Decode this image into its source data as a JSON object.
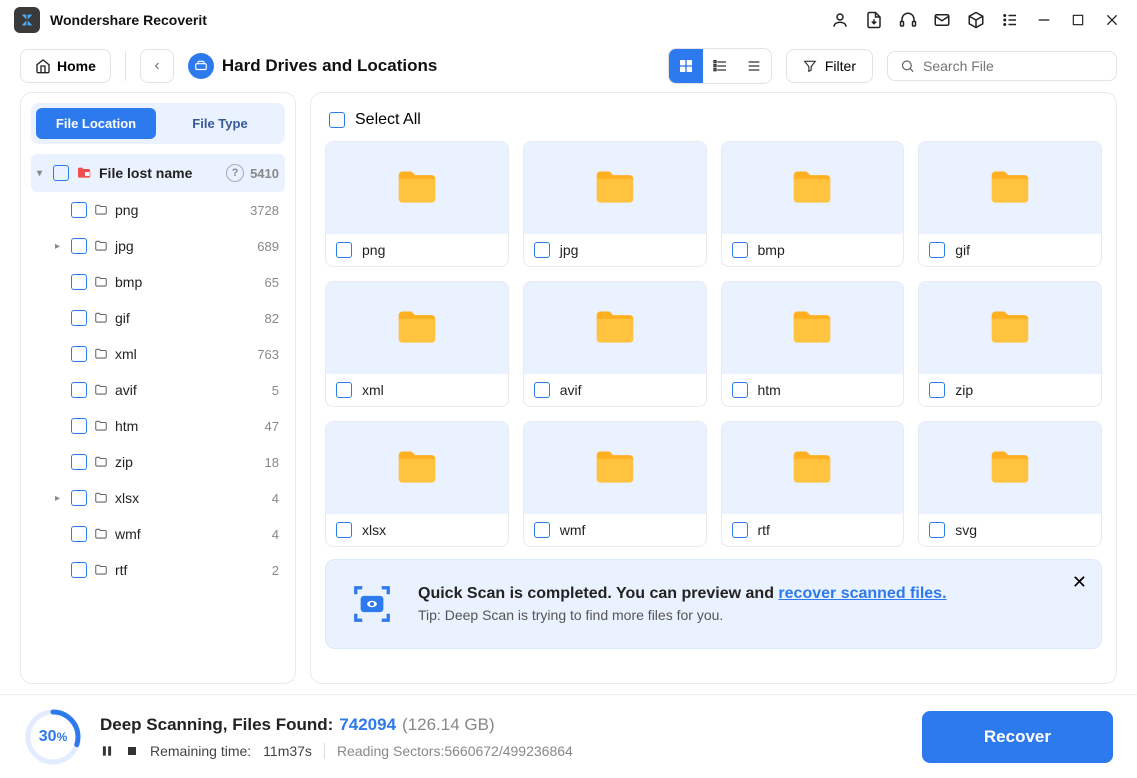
{
  "app_title": "Wondershare Recoverit",
  "toolbar": {
    "home": "Home",
    "location": "Hard Drives and Locations",
    "filter": "Filter",
    "search_placeholder": "Search File"
  },
  "sidebar": {
    "tabs": {
      "location": "File Location",
      "type": "File Type"
    },
    "root": {
      "name": "File lost name",
      "count": "5410"
    },
    "items": [
      {
        "name": "png",
        "count": "3728",
        "expandable": false
      },
      {
        "name": "jpg",
        "count": "689",
        "expandable": true
      },
      {
        "name": "bmp",
        "count": "65",
        "expandable": false
      },
      {
        "name": "gif",
        "count": "82",
        "expandable": false
      },
      {
        "name": "xml",
        "count": "763",
        "expandable": false
      },
      {
        "name": "avif",
        "count": "5",
        "expandable": false
      },
      {
        "name": "htm",
        "count": "47",
        "expandable": false
      },
      {
        "name": "zip",
        "count": "18",
        "expandable": false
      },
      {
        "name": "xlsx",
        "count": "4",
        "expandable": true
      },
      {
        "name": "wmf",
        "count": "4",
        "expandable": false
      },
      {
        "name": "rtf",
        "count": "2",
        "expandable": false
      }
    ]
  },
  "content": {
    "select_all": "Select All",
    "folders": [
      "png",
      "jpg",
      "bmp",
      "gif",
      "xml",
      "avif",
      "htm",
      "zip",
      "xlsx",
      "wmf",
      "rtf",
      "svg"
    ]
  },
  "banner": {
    "title_a": "Quick Scan is completed. You can preview and ",
    "link": "recover scanned files.",
    "tip": "Tip: Deep Scan is trying to find more files for you."
  },
  "footer": {
    "percent": "30",
    "pct_sym": "%",
    "label": "Deep Scanning, Files Found: ",
    "files": "742094",
    "size": "(126.14 GB)",
    "remaining_label": "Remaining time:",
    "remaining_value": "11m37s",
    "sectors": "Reading Sectors:5660672/499236864",
    "recover": "Recover"
  }
}
